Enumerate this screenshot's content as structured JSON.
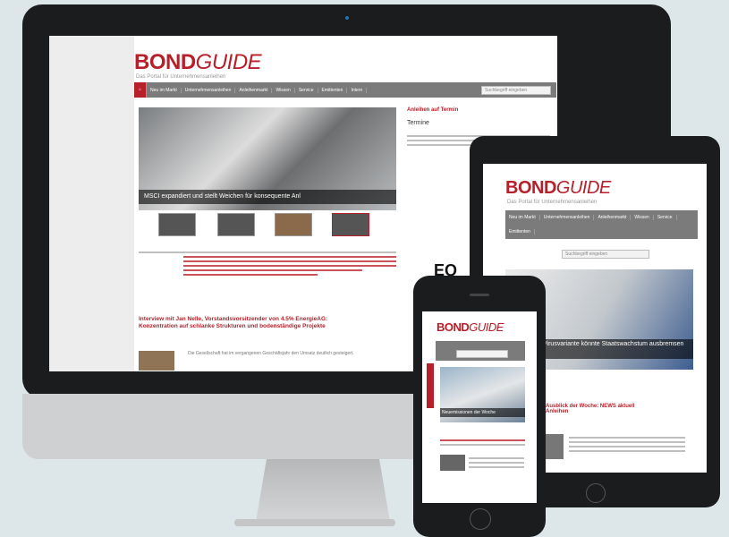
{
  "brand": {
    "bond": "BOND",
    "guide": "GUIDE"
  },
  "tagline": "Das Portal für Unternehmensanleihen",
  "nav": {
    "items": [
      "Neu im Markt",
      "Unternehmensanleihen",
      "Anleihenmarkt",
      "Wissen",
      "Service",
      "Emittenten",
      "Intern"
    ],
    "search_placeholder": "Suchbegriff eingeben"
  },
  "hero": {
    "caption": "MSCI expandiert und stellt Weichen für konsequente Anl"
  },
  "sidebar": {
    "title": "Anleihen auf Termin",
    "sub": "Termine",
    "logo_text": "EQ"
  },
  "article": {
    "title": "Interview mit Jan Nelle, Vorstandsvorsitzender von 4.5% EnergieAG: Konzentration auf schlanke Strukturen und bodenständige Projekte",
    "body": "Die Gesellschaft hat im vergangenen Geschäftsjahr den Umsatz deutlich gesteigert."
  },
  "tablet": {
    "caption": "Virusvariante könnte Staatswachstum ausbremsen",
    "article_title": "Ausblick der Woche: NEWS aktuell Anleihen"
  },
  "phone": {
    "caption": "Neuemissionen der Woche"
  }
}
